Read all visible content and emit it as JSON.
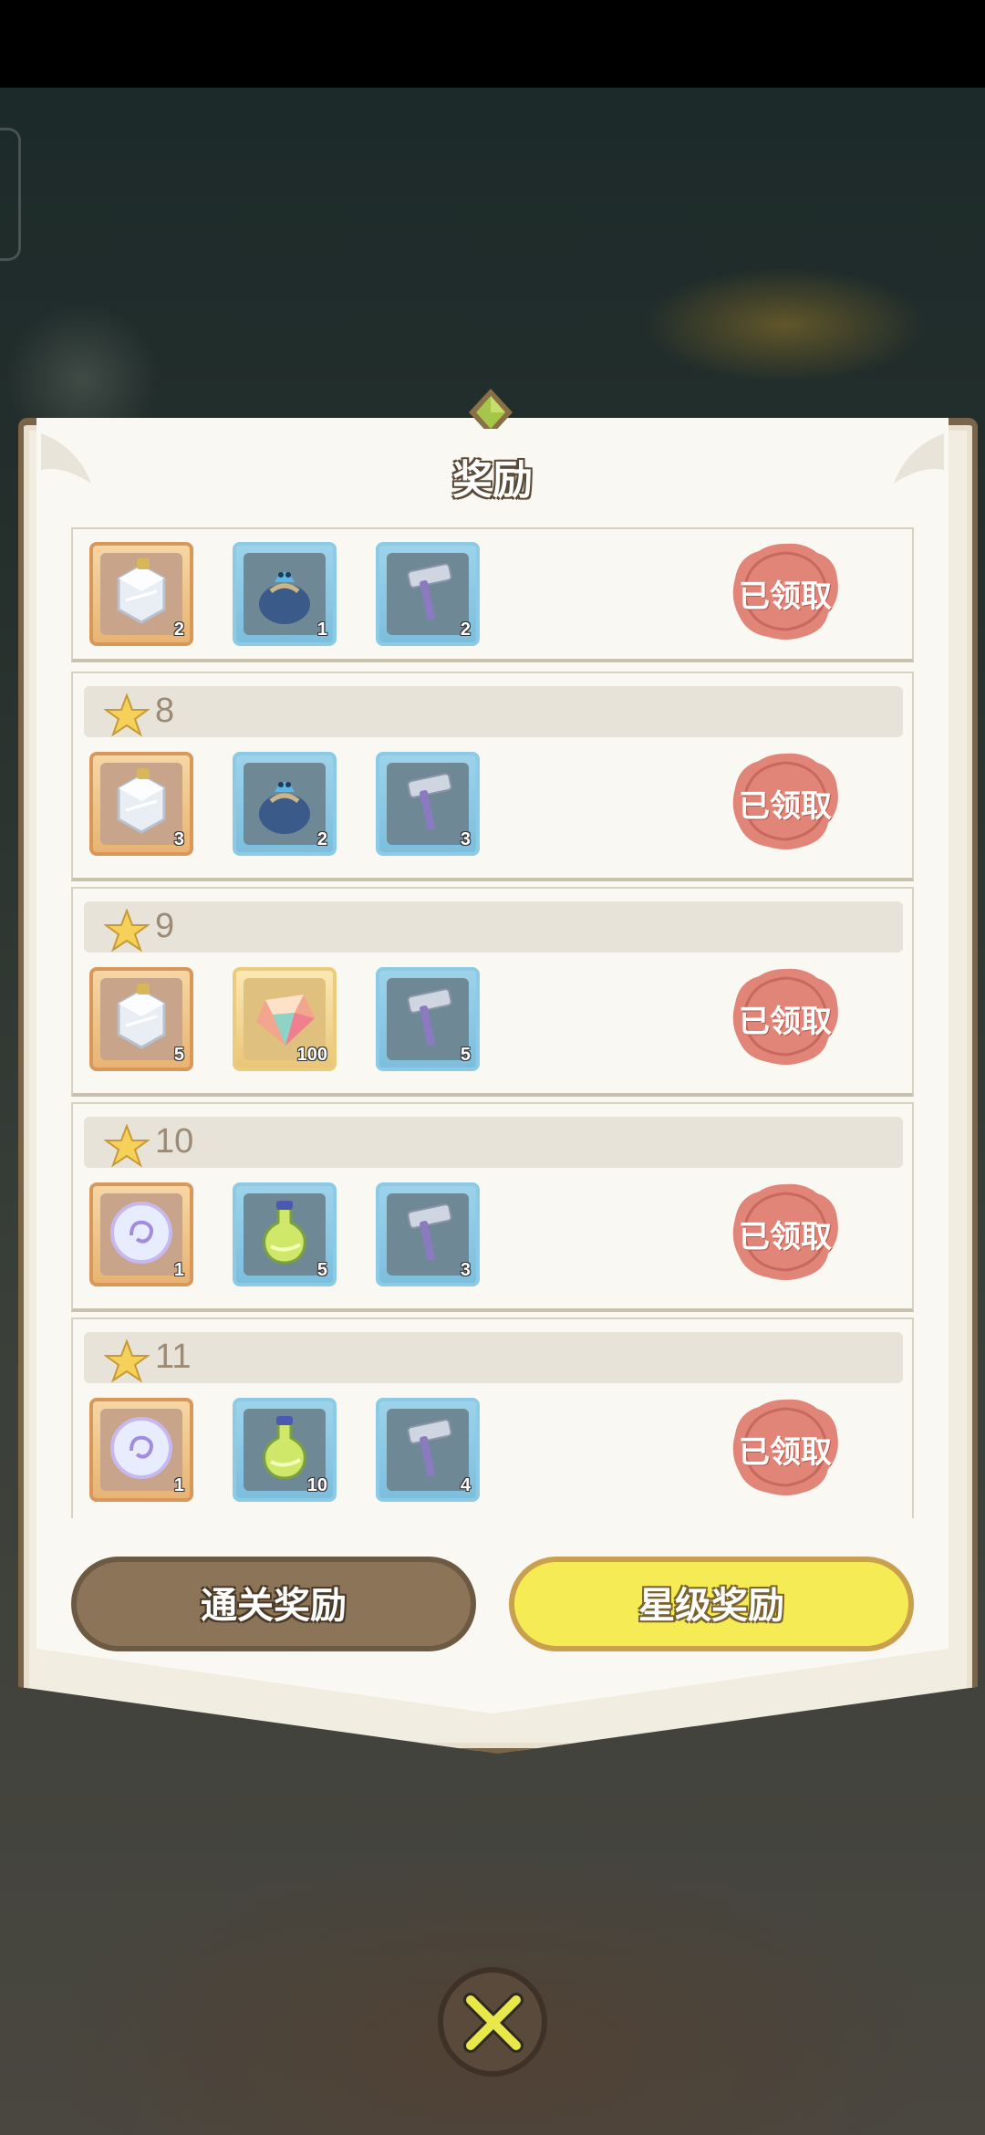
{
  "panel": {
    "title": "奖励"
  },
  "rows": [
    {
      "star": "",
      "items": [
        {
          "icon": "glass-bottle-icon",
          "qty": "2",
          "frame": "orange"
        },
        {
          "icon": "blue-pouch-icon",
          "qty": "1",
          "frame": "blue"
        },
        {
          "icon": "hammer-icon",
          "qty": "2",
          "frame": "blue"
        }
      ],
      "status": "已领取"
    },
    {
      "star": "8",
      "items": [
        {
          "icon": "glass-bottle-icon",
          "qty": "3",
          "frame": "orange"
        },
        {
          "icon": "blue-pouch-icon",
          "qty": "2",
          "frame": "blue"
        },
        {
          "icon": "hammer-icon",
          "qty": "3",
          "frame": "blue"
        }
      ],
      "status": "已领取"
    },
    {
      "star": "9",
      "items": [
        {
          "icon": "glass-bottle-icon",
          "qty": "5",
          "frame": "orange"
        },
        {
          "icon": "crystal-gem-icon",
          "qty": "100",
          "frame": "gold"
        },
        {
          "icon": "hammer-icon",
          "qty": "5",
          "frame": "blue"
        }
      ],
      "status": "已领取"
    },
    {
      "star": "10",
      "items": [
        {
          "icon": "swirl-orb-icon",
          "qty": "1",
          "frame": "orange"
        },
        {
          "icon": "green-potion-icon",
          "qty": "5",
          "frame": "blue"
        },
        {
          "icon": "hammer-icon",
          "qty": "3",
          "frame": "blue"
        }
      ],
      "status": "已领取"
    },
    {
      "star": "11",
      "items": [
        {
          "icon": "swirl-orb-icon",
          "qty": "1",
          "frame": "orange"
        },
        {
          "icon": "green-potion-icon",
          "qty": "10",
          "frame": "blue"
        },
        {
          "icon": "hammer-icon",
          "qty": "4",
          "frame": "blue"
        }
      ],
      "status": "已领取"
    }
  ],
  "tabs": {
    "clear_label": "通关奖励",
    "star_label": "星级奖励",
    "active": "star"
  },
  "colors": {
    "panel_border": "#7a6548",
    "seal": "#e07f73",
    "active_tab": "#f5ec55",
    "inactive_tab": "#8c7458"
  },
  "close_icon": "close-x-icon"
}
